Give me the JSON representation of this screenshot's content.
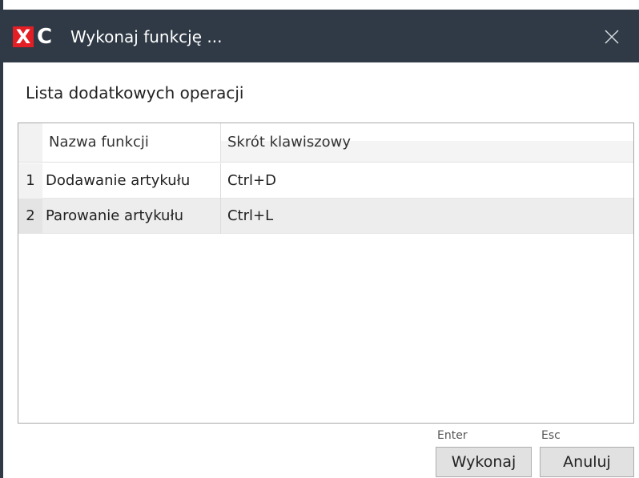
{
  "window": {
    "logo_x": "X",
    "logo_c": "C",
    "title": "Wykonaj funkcję ...",
    "colors": {
      "titlebar": "#2f3a46",
      "logo_red": "#e31e24"
    },
    "close_icon": "close-icon"
  },
  "subtitle": "Lista dodatkowych operacji",
  "grid": {
    "columns": [
      "Nazwa funkcji",
      "Skrót klawiszowy"
    ],
    "rows": [
      {
        "index": "1",
        "name": "Dodawanie artykułu",
        "shortcut": "Ctrl+D"
      },
      {
        "index": "2",
        "name": "Parowanie artykułu",
        "shortcut": "Ctrl+L"
      }
    ]
  },
  "footer": {
    "ok_hint": "Enter",
    "cancel_hint": "Esc",
    "ok_label": "Wykonaj",
    "cancel_label": "Anuluj"
  }
}
